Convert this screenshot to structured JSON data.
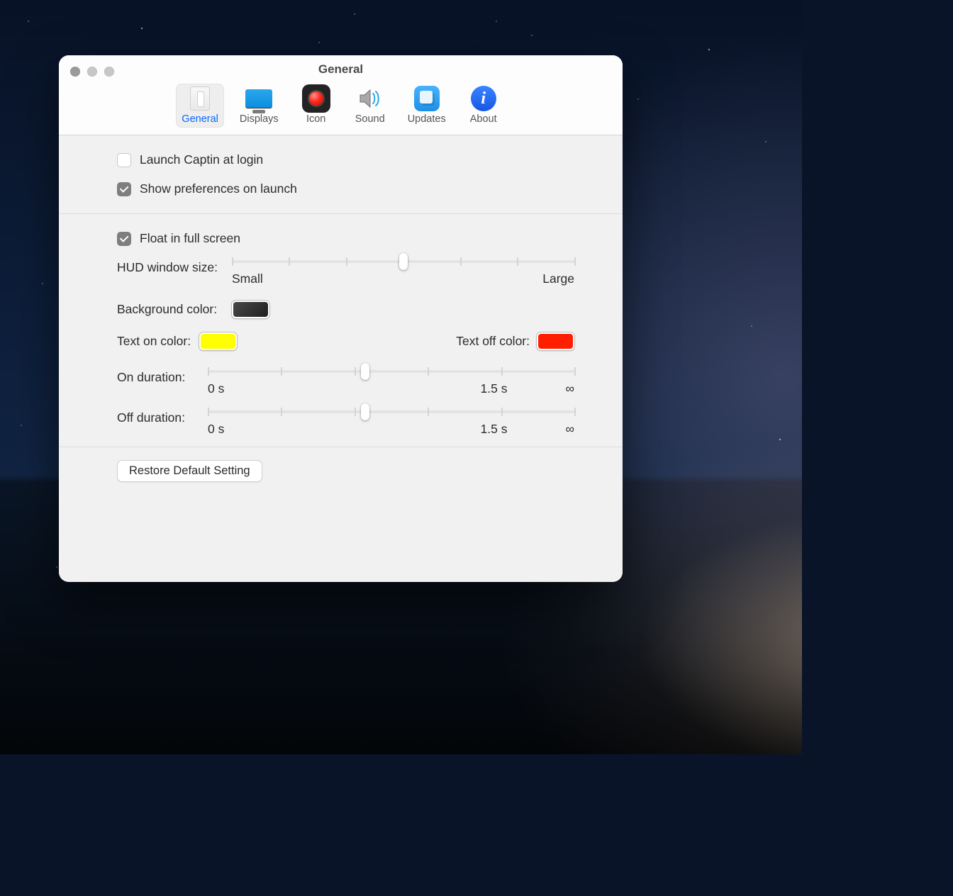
{
  "window": {
    "title": "General"
  },
  "toolbar": {
    "items": [
      {
        "id": "general",
        "label": "General",
        "active": true
      },
      {
        "id": "displays",
        "label": "Displays",
        "active": false
      },
      {
        "id": "icon",
        "label": "Icon",
        "active": false
      },
      {
        "id": "sound",
        "label": "Sound",
        "active": false
      },
      {
        "id": "updates",
        "label": "Updates",
        "active": false
      },
      {
        "id": "about",
        "label": "About",
        "active": false
      }
    ]
  },
  "prefs": {
    "launch_at_login": {
      "label": "Launch Captin at login",
      "checked": false
    },
    "show_prefs_on_launch": {
      "label": "Show preferences on launch",
      "checked": true
    },
    "float_fullscreen": {
      "label": "Float in full screen",
      "checked": true
    },
    "hud_size": {
      "label": "HUD window size:",
      "min_label": "Small",
      "max_label": "Large",
      "value_percent": 50,
      "ticks": 7
    },
    "background_color": {
      "label": "Background color:",
      "value": "#2b2b2b"
    },
    "text_on_color": {
      "label": "Text on color:",
      "value": "#ffff00"
    },
    "text_off_color": {
      "label": "Text off color:",
      "value": "#ff1e00"
    },
    "on_duration": {
      "label": "On duration:",
      "ticks": 6,
      "value_percent": 43,
      "labels": [
        "0 s",
        "1.5 s",
        "∞"
      ]
    },
    "off_duration": {
      "label": "Off duration:",
      "ticks": 6,
      "value_percent": 43,
      "labels": [
        "0 s",
        "1.5 s",
        "∞"
      ]
    }
  },
  "footer": {
    "restore_label": "Restore Default Setting"
  }
}
